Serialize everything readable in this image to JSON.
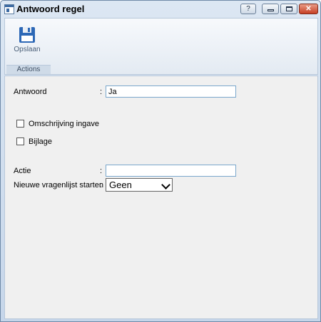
{
  "window": {
    "title": "Antwoord regel",
    "help_label": "?",
    "close_label": "✕"
  },
  "ribbon": {
    "save_label": "Opslaan",
    "group_label": "Actions"
  },
  "form": {
    "antwoord": {
      "label": "Antwoord",
      "value": "Ja"
    },
    "omschrijving": {
      "label": "Omschrijving ingave",
      "checked": false
    },
    "bijlage": {
      "label": "Bijlage",
      "checked": false
    },
    "actie": {
      "label": "Actie",
      "value": ""
    },
    "nieuwe": {
      "label": "Nieuwe vragenlijst starten",
      "selected": "Geen"
    },
    "colon": ":"
  },
  "colors": {
    "accent": "#2d68b6",
    "close": "#c63f24"
  }
}
